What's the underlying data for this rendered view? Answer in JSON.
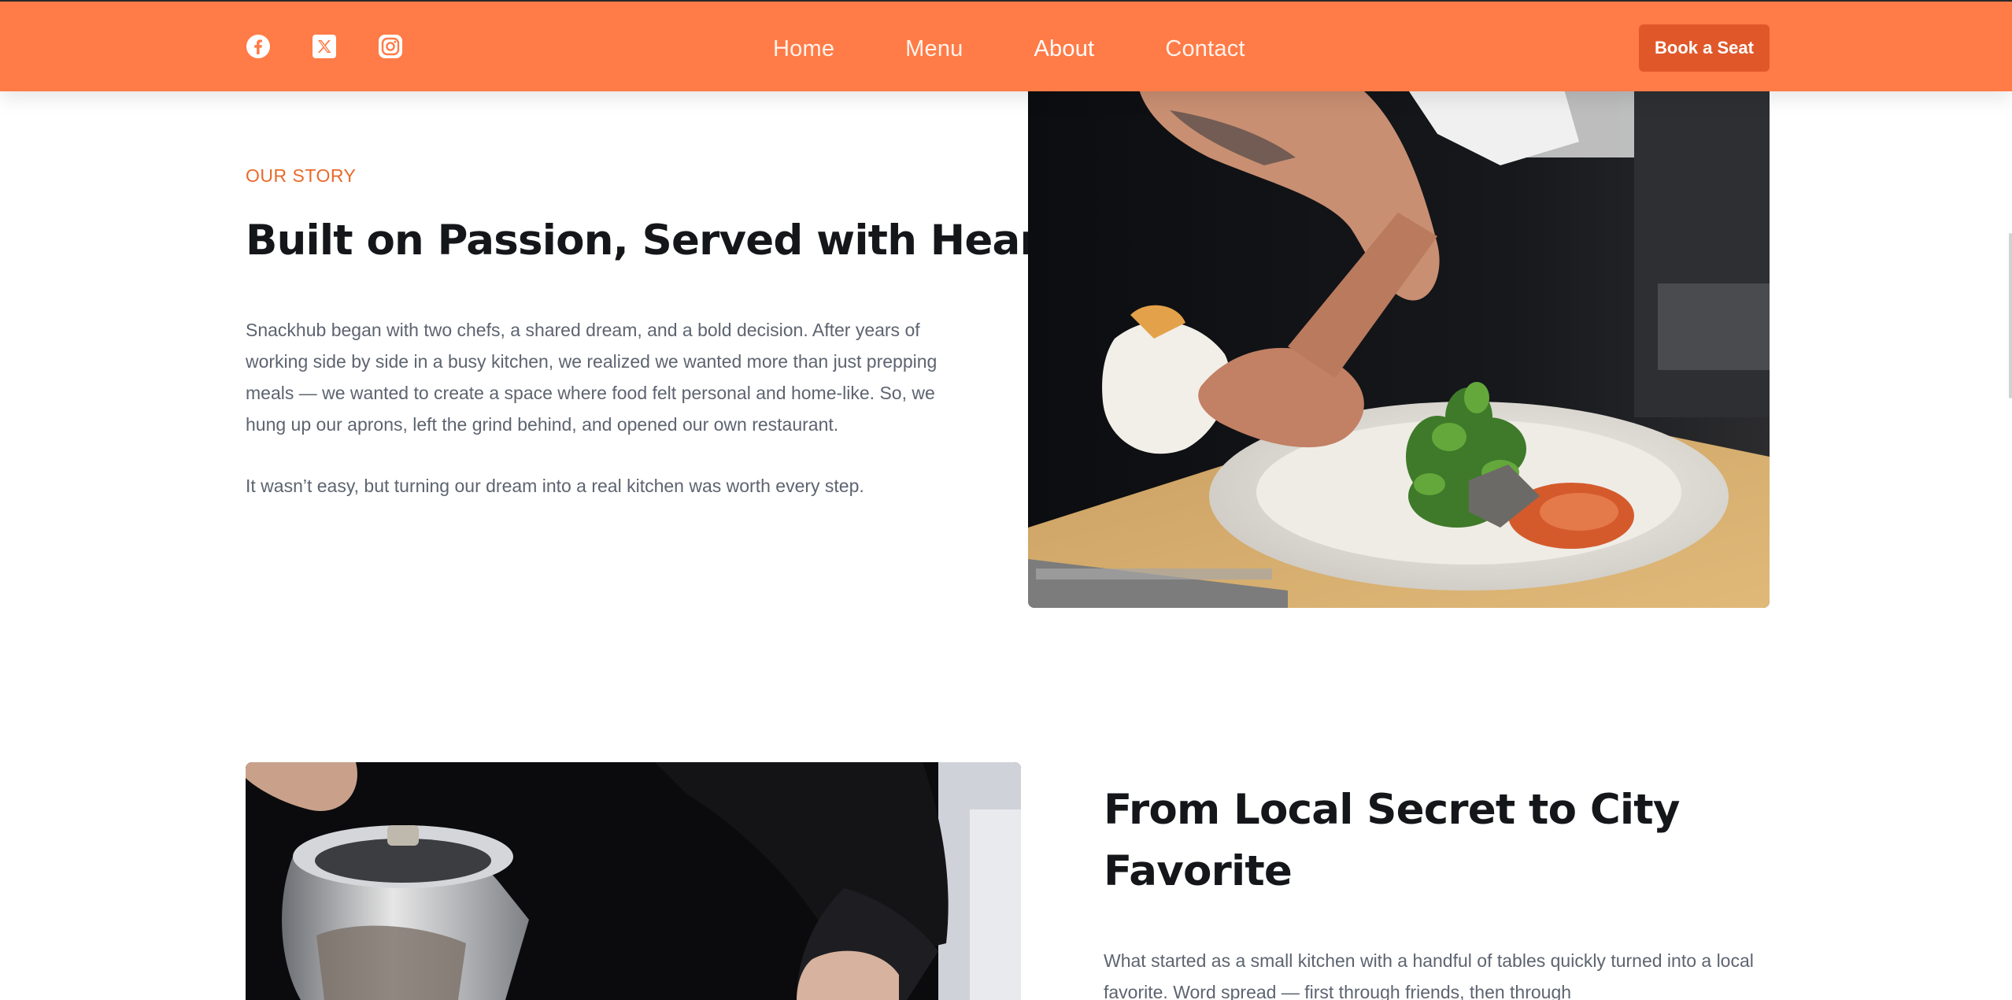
{
  "header": {
    "social": [
      {
        "icon": "facebook-icon"
      },
      {
        "icon": "x-icon"
      },
      {
        "icon": "instagram-icon"
      }
    ],
    "nav": [
      {
        "label": "Home",
        "active": false
      },
      {
        "label": "Menu",
        "active": false
      },
      {
        "label": "About",
        "active": true
      },
      {
        "label": "Contact",
        "active": false
      }
    ],
    "cta_label": "Book a Seat",
    "colors": {
      "bar": "#ff7b47",
      "cta": "#e0582a",
      "accent": "#e86a2c"
    }
  },
  "story": {
    "eyebrow": "OUR STORY",
    "title": "Built on Passion, Served with Heart",
    "paragraph_1": "Snackhub began with two chefs, a shared dream, and a bold decision. After years of working side by side in a busy kitchen, we realized we wanted more than just prepping meals — we wanted to create a space where food felt personal and home-like. So, we hung up our aprons, left the grind behind, and opened our own restaurant.",
    "paragraph_2": "It wasn’t easy, but turning our dream into a real kitchen was worth every step.",
    "image": "chef-plating-icon"
  },
  "favorite": {
    "title": "From Local Secret to City Favorite",
    "paragraph": "What started as a small kitchen with a handful of tables quickly turned into a local favorite. Word spread — first through friends, then through",
    "image": "chef-pouring-icon"
  }
}
